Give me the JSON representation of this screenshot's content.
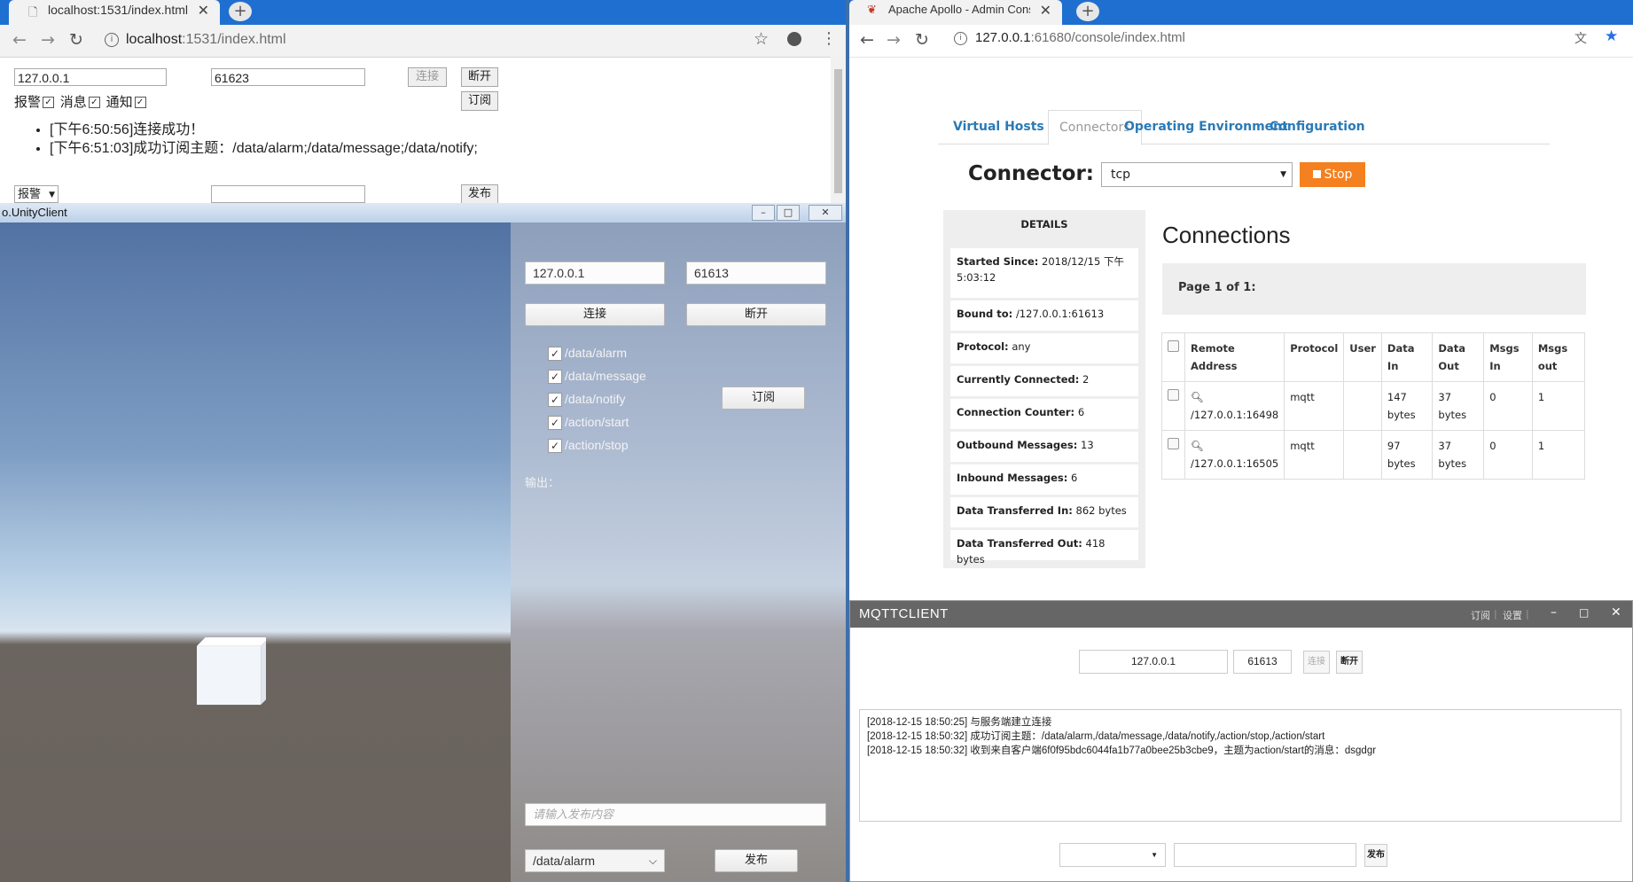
{
  "left_browser": {
    "tab_title": "localhost:1531/index.html",
    "new_tab": "+",
    "url_host": "localhost",
    "url_rest": ":1531/index.html",
    "host_input": "127.0.0.1",
    "port_input": "61623",
    "connect_label": "连接",
    "disconnect_label": "断开",
    "subscribe_label": "订阅",
    "chk_alarm": "报警",
    "chk_message": "消息",
    "chk_notify": "通知",
    "log": [
      "[下午6:50:56]连接成功！",
      "[下午6:51:03]成功订阅主题：/data/alarm;/data/message;/data/notify;"
    ],
    "select_value": "报警",
    "publish_label": "发布"
  },
  "unity": {
    "title": "o.UnityClient",
    "host": "127.0.0.1",
    "port": "61613",
    "connect_label": "连接",
    "disconnect_label": "断开",
    "topics": [
      "/data/alarm",
      "/data/message",
      "/data/notify",
      "/action/start",
      "/action/stop"
    ],
    "subscribe_label": "订阅",
    "output_label": "输出：",
    "publish_placeholder": "请输入发布内容",
    "topic_select": "/data/alarm",
    "publish_label": "发布"
  },
  "right_browser": {
    "tab_title": "Apache Apollo - Admin Conso",
    "url_host": "127.0.0.1",
    "url_rest": ":61680/console/index.html",
    "tabs": [
      "Virtual Hosts",
      "Connectors",
      "Operating Environment",
      "Configuration"
    ],
    "connector_label": "Connector:",
    "connector_value": "tcp",
    "stop_label": "Stop",
    "details_header": "DETAILS",
    "details": [
      {
        "k": "Started Since:",
        "v": "2018/12/15 下午 5:03:12"
      },
      {
        "k": "Bound to:",
        "v": "/127.0.0.1:61613"
      },
      {
        "k": "Protocol:",
        "v": "any"
      },
      {
        "k": "Currently Connected:",
        "v": "2"
      },
      {
        "k": "Connection Counter:",
        "v": "6"
      },
      {
        "k": "Outbound Messages:",
        "v": "13"
      },
      {
        "k": "Inbound Messages:",
        "v": "6"
      },
      {
        "k": "Data Transferred In:",
        "v": "862 bytes"
      },
      {
        "k": "Data Transferred Out:",
        "v": "418 bytes"
      }
    ],
    "connections_title": "Connections",
    "page_info": "Page 1 of 1:",
    "table_headers": [
      "Remote Address",
      "Protocol",
      "User",
      "Data In",
      "Data Out",
      "Msgs In",
      "Msgs out"
    ],
    "rows": [
      {
        "address": "/127.0.0.1:16498",
        "protocol": "mqtt",
        "user": "",
        "data_in": "147 bytes",
        "data_out": "37 bytes",
        "msgs_in": "0",
        "msgs_out": "1"
      },
      {
        "address": "/127.0.0.1:16505",
        "protocol": "mqtt",
        "user": "",
        "data_in": "97 bytes",
        "data_out": "37 bytes",
        "msgs_in": "0",
        "msgs_out": "1"
      }
    ]
  },
  "mqtt_client": {
    "title": "MQTTCLIENT",
    "menu_subscribe": "订阅",
    "menu_settings": "设置",
    "host": "127.0.0.1",
    "port": "61613",
    "connect_label": "连接",
    "disconnect_label": "断开",
    "log": [
      "[2018-12-15 18:50:25] 与服务端建立连接",
      "[2018-12-15 18:50:32] 成功订阅主题：/data/alarm,/data/message,/data/notify,/action/stop,/action/start",
      "[2018-12-15 18:50:32] 收到来自客户端6f0f95bdc6044fa1b77a0bee25b3cbe9，主题为action/start的消息：dsgdgr"
    ],
    "publish_label": "发布"
  }
}
